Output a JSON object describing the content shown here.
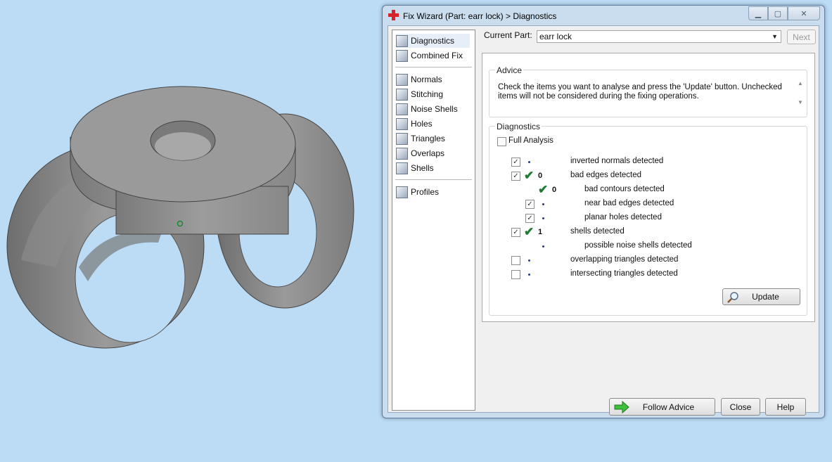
{
  "window": {
    "title": "Fix Wizard (Part: earr lock) > Diagnostics",
    "caption_icons": [
      "minimize-icon",
      "maximize-icon",
      "close-icon"
    ]
  },
  "nav": {
    "top": [
      {
        "label": "Diagnostics",
        "icon": "magnifier-icon",
        "selected": true
      },
      {
        "label": "Combined Fix",
        "icon": "cube-icon"
      }
    ],
    "fixes": [
      {
        "label": "Normals",
        "icon": "normals-cube-icon"
      },
      {
        "label": "Stitching",
        "icon": "stitching-cube-icon"
      },
      {
        "label": "Noise Shells",
        "icon": "noise-shells-icon"
      },
      {
        "label": "Holes",
        "icon": "holes-cube-icon"
      },
      {
        "label": "Triangles",
        "icon": "triangles-cube-icon"
      },
      {
        "label": "Overlaps",
        "icon": "overlaps-cube-icon"
      },
      {
        "label": "Shells",
        "icon": "shells-cube-icon"
      }
    ],
    "bottom": [
      {
        "label": "Profiles",
        "icon": "document-icon"
      }
    ]
  },
  "current_part": {
    "label": "Current Part:",
    "value": "earr lock"
  },
  "next_label": "Next",
  "advice": {
    "title": "Advice",
    "text": "Check the items you want to analyse and press the 'Update' button. Unchecked items will not be considered during the fixing operations."
  },
  "diagnostics": {
    "title": "Diagnostics",
    "full_analysis_label": "Full Analysis",
    "full_analysis_checked": false,
    "rows": [
      {
        "label": "inverted normals detected",
        "checked": true,
        "count": "",
        "ok": false,
        "indent": 0,
        "has_checkbox": true
      },
      {
        "label": "bad edges detected",
        "checked": true,
        "count": "0",
        "ok": true,
        "indent": 0,
        "has_checkbox": true
      },
      {
        "label": "bad contours detected",
        "checked": false,
        "count": "0",
        "ok": true,
        "indent": 1,
        "has_checkbox": false
      },
      {
        "label": "near bad edges detected",
        "checked": true,
        "count": "",
        "ok": false,
        "indent": 1,
        "has_checkbox": true
      },
      {
        "label": "planar holes detected",
        "checked": true,
        "count": "",
        "ok": false,
        "indent": 1,
        "has_checkbox": true
      },
      {
        "label": "shells detected",
        "checked": true,
        "count": "1",
        "ok": true,
        "indent": 0,
        "has_checkbox": true
      },
      {
        "label": "possible noise shells detected",
        "checked": false,
        "count": "",
        "ok": false,
        "indent": 1,
        "has_checkbox": false
      },
      {
        "label": "overlapping triangles detected",
        "checked": false,
        "count": "",
        "ok": false,
        "indent": 0,
        "has_checkbox": true
      },
      {
        "label": "intersecting triangles detected",
        "checked": false,
        "count": "",
        "ok": false,
        "indent": 0,
        "has_checkbox": true
      }
    ]
  },
  "buttons": {
    "update": "Update",
    "follow_advice": "Follow Advice",
    "close": "Close",
    "help": "Help"
  },
  "colors": {
    "viewport_bg": "#bcdcf6",
    "model_gray": "#8c8c8c",
    "ok_green": "#1f7a32"
  }
}
